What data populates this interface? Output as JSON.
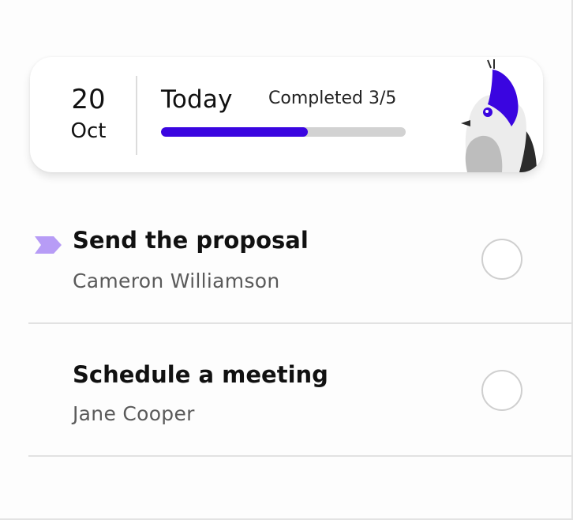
{
  "header": {
    "date_day": "20",
    "date_month": "Oct",
    "title": "Today",
    "completed_label": "Completed 3/5",
    "progress": {
      "completed": 3,
      "total": 5,
      "fraction": 0.6
    },
    "accent_color": "#3a05e0",
    "mascot_icon": "bird-mascot-icon"
  },
  "tasks": [
    {
      "title": "Send the proposal",
      "assignee": "Cameron Williamson",
      "flagged": true,
      "flag_color": "#b79cf6",
      "done": false
    },
    {
      "title": "Schedule a meeting",
      "assignee": "Jane Cooper",
      "flagged": false,
      "done": false
    }
  ]
}
